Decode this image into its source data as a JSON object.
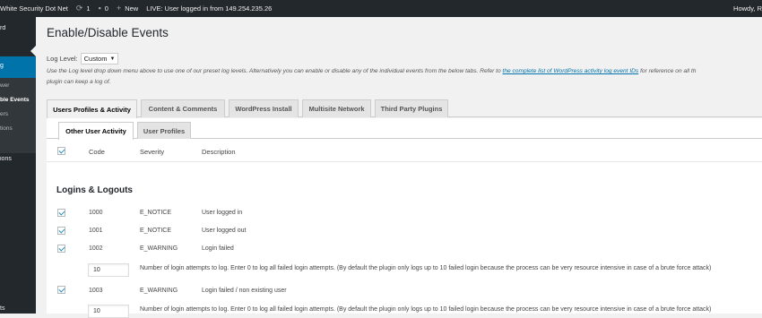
{
  "adminbar": {
    "site_name": "White Security Dot Net",
    "updates_count": "1",
    "comments_count": "0",
    "new_label": "New",
    "live_text": "LIVE: User logged in from 149.254.235.26",
    "howdy": "Howdy, R",
    "icons": {
      "updates": "refresh-icon",
      "comments": "comment-icon",
      "new": "plus-icon"
    }
  },
  "sidebar": {
    "items": [
      {
        "label": "rd"
      },
      {
        "label": "g"
      },
      {
        "label": "wer"
      },
      {
        "label": "ble Events"
      },
      {
        "label": "ers"
      },
      {
        "label": "tions"
      },
      {
        "label": "ions"
      },
      {
        "label": "ts"
      }
    ]
  },
  "page": {
    "title": "Enable/Disable Events",
    "log_level_label": "Log Level:",
    "log_level_value": "Custom",
    "help_text_1": "Use the Log level drop down menu above to use one of our preset log levels. Alternatively you can enable or disable any of the individual events from the below tabs. Refer to ",
    "help_link": "the complete list of WordPress activity log event IDs",
    "help_text_2": " for reference on all th",
    "help_text_3": "plugin can keep a log of."
  },
  "tabs": [
    {
      "label": "Users Profiles & Activity"
    },
    {
      "label": "Content & Comments"
    },
    {
      "label": "WordPress Install"
    },
    {
      "label": "Multisite Network"
    },
    {
      "label": "Third Party Plugins"
    }
  ],
  "subtabs": [
    {
      "label": "Other User Activity"
    },
    {
      "label": "User Profiles"
    }
  ],
  "table": {
    "headers": {
      "code": "Code",
      "severity": "Severity",
      "description": "Description"
    },
    "section": "Logins & Logouts",
    "rows": [
      {
        "code": "1000",
        "severity": "E_NOTICE",
        "description": "User logged in"
      },
      {
        "code": "1001",
        "severity": "E_NOTICE",
        "description": "User logged out"
      },
      {
        "code": "1002",
        "severity": "E_WARNING",
        "description": "Login failed"
      },
      {
        "code": "1003",
        "severity": "E_WARNING",
        "description": "Login failed / non existing user"
      }
    ],
    "attempts_value_1": "10",
    "attempts_value_2": "10",
    "attempts_help": "Number of login attempts to log. Enter 0 to log all failed login attempts. (By default the plugin only logs up to 10 failed login because the process can be very resource intensive in case of a brute force attack)"
  },
  "colors": {
    "adminbar": "#23282d",
    "accent": "#0073aa",
    "checkmark": "#1e8cbe"
  }
}
